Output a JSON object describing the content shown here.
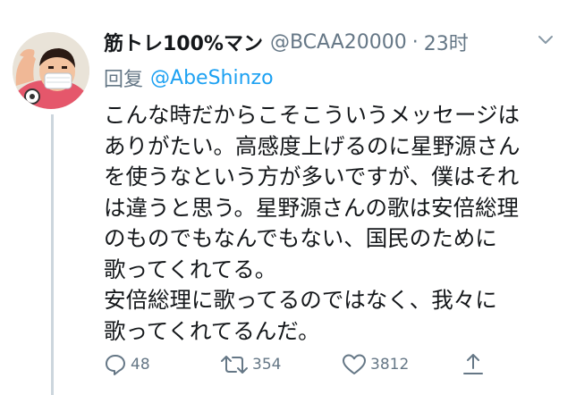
{
  "tweet": {
    "display_name": "筋トレ100%マン",
    "handle": "@BCAA20000",
    "separator": "·",
    "time": "23时",
    "reply_label": "回复",
    "reply_target": "@AbeShinzo",
    "lines": [
      "こんな時だからこそこういうメッセージは",
      "ありがたい。高感度上げるのに星野源さん",
      "を使うなという方が多いですが、僕はそれ",
      "は違うと思う。星野源さんの歌は安倍総理",
      "のものでもなんでもない、国民のために",
      "歌ってくれてる。",
      "安倍総理に歌ってるのではなく、我々に",
      "歌ってくれてるんだ。"
    ],
    "actions": {
      "reply_count": "48",
      "retweet_count": "354",
      "like_count": "3812"
    }
  },
  "icons": {
    "menu": "chevron-down-icon",
    "reply": "reply-icon",
    "retweet": "retweet-icon",
    "like": "heart-icon",
    "share": "share-icon"
  },
  "colors": {
    "text": "#14171a",
    "muted": "#657786",
    "link": "#1da1f2",
    "thread_line": "#ccd6dd"
  }
}
